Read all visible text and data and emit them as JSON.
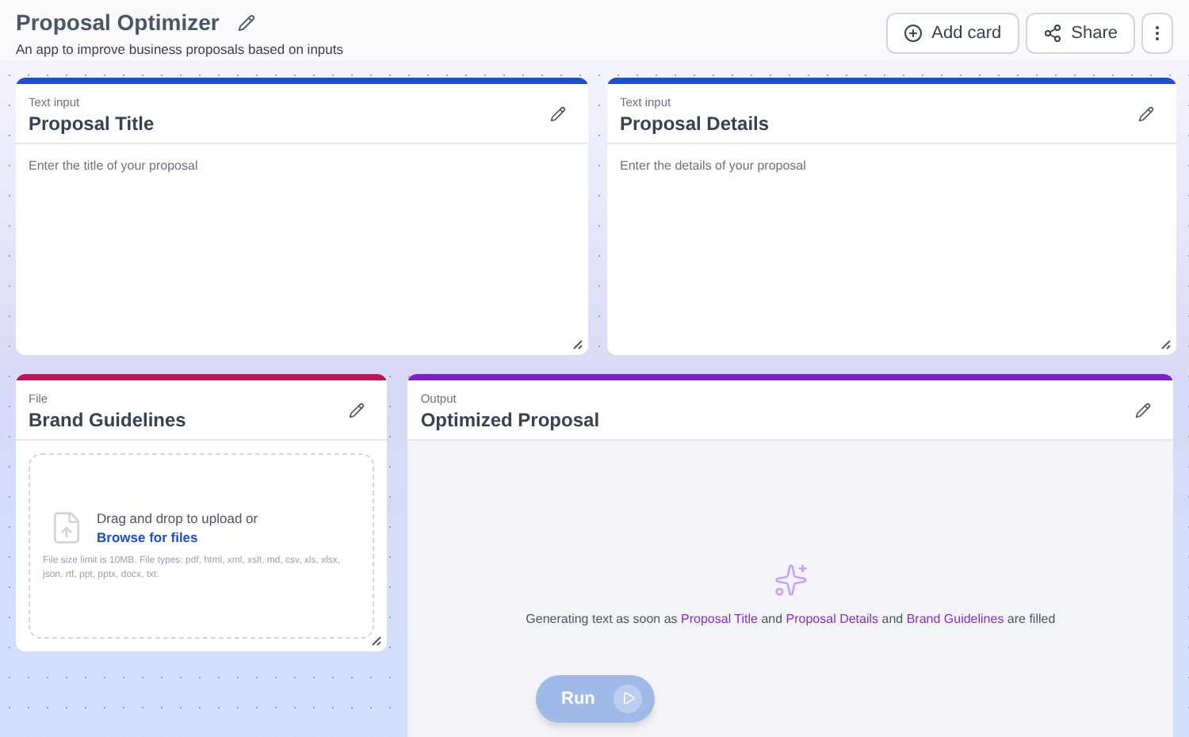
{
  "header": {
    "title": "Proposal Optimizer",
    "subtitle": "An app to improve business proposals based on inputs",
    "buttons": [
      {
        "kind": "add",
        "label": "Add card"
      },
      {
        "kind": "share",
        "label": "Share"
      },
      {
        "kind": "more"
      }
    ]
  },
  "cards": [
    {
      "kind": "text_input",
      "type_label": "Text input",
      "title": "Proposal Title",
      "color": "#1d4fd0",
      "placeholder": "Enter the title of your proposal"
    },
    {
      "kind": "text_input",
      "type_label": "Text input",
      "title": "Proposal Details",
      "color": "#1d4fd0",
      "placeholder": "Enter the details of your proposal"
    },
    {
      "kind": "file",
      "type_label": "File",
      "title": "Brand Guidelines",
      "color": "#be1558",
      "drop_text": "Drag and drop to upload or",
      "browse_link": "Browse for files",
      "limits": "File size limit is 10MB. File types: pdf, html, xml, xslt, md, csv, xls, xlsx, json, rtf, ppt, pptx, docx, txt."
    },
    {
      "kind": "output",
      "type_label": "Output",
      "title": "Optimized Proposal",
      "color": "#7e1fcf",
      "message": [
        {
          "kind": "text",
          "text": "Generating text as soon as "
        },
        {
          "kind": "ref",
          "text": "Proposal Title"
        },
        {
          "kind": "text",
          "text": " and "
        },
        {
          "kind": "ref",
          "text": "Proposal Details"
        },
        {
          "kind": "text",
          "text": " and "
        },
        {
          "kind": "ref",
          "text": "Brand Guidelines"
        },
        {
          "kind": "text",
          "text": " are filled"
        }
      ]
    }
  ],
  "run_button": {
    "label": "Run",
    "disabled": true
  }
}
